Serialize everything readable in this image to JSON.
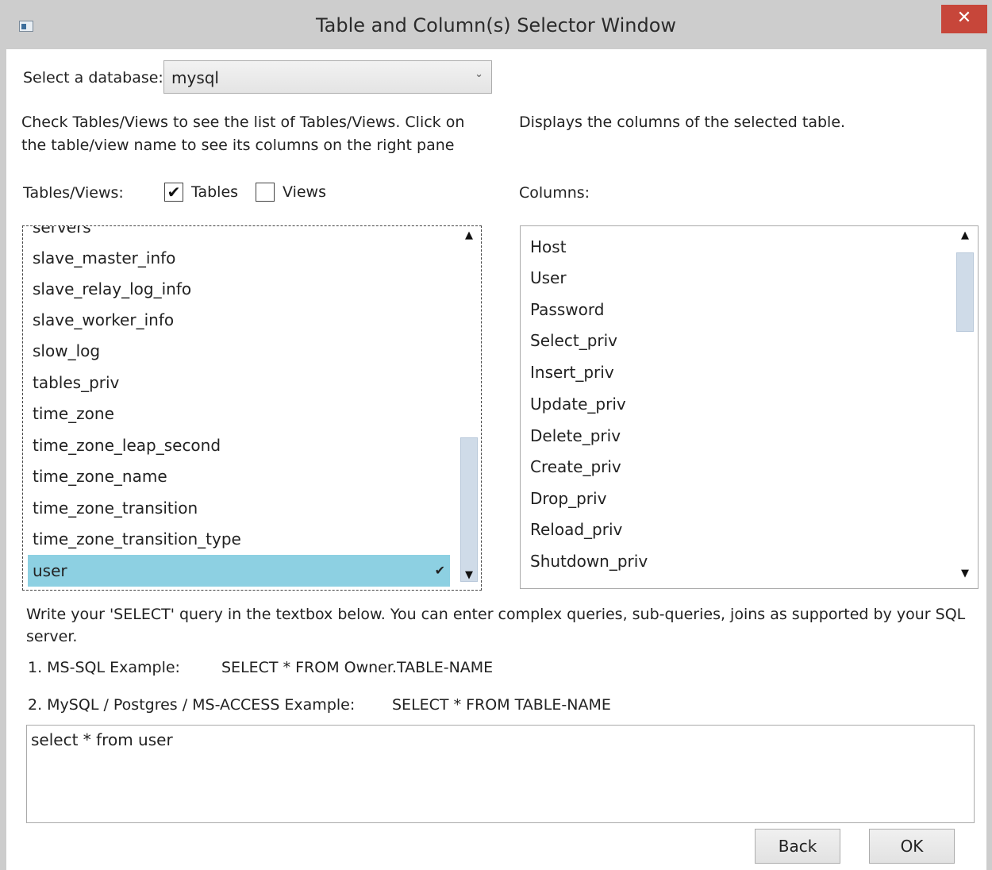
{
  "window": {
    "title": "Table and Column(s) Selector Window",
    "close_glyph": "✕"
  },
  "database": {
    "label": "Select a database:",
    "selected": "mysql",
    "arrow": "⌄"
  },
  "left_help": {
    "line1": "Check Tables/Views to see the list of Tables/Views. Click on",
    "line2": "the table/view name to see its columns on the right pane"
  },
  "right_help": "Displays the columns of the selected table.",
  "filters": {
    "label": "Tables/Views:",
    "tables": {
      "label": "Tables",
      "checked": true,
      "mark": "✔"
    },
    "views": {
      "label": "Views",
      "checked": false,
      "mark": ""
    }
  },
  "columns_label": "Columns:",
  "tables_list": {
    "partial_top": "servers",
    "items": [
      "slave_master_info",
      "slave_relay_log_info",
      "slave_worker_info",
      "slow_log",
      "tables_priv",
      "time_zone",
      "time_zone_leap_second",
      "time_zone_name",
      "time_zone_transition",
      "time_zone_transition_type"
    ],
    "selected": "user",
    "selected_mark": "✔"
  },
  "columns_list": {
    "items": [
      "Host",
      "User",
      "Password",
      "Select_priv",
      "Insert_priv",
      "Update_priv",
      "Delete_priv",
      "Create_priv",
      "Drop_priv",
      "Reload_priv",
      "Shutdown_priv"
    ]
  },
  "scroll": {
    "up": "▲",
    "down": "▼"
  },
  "query_help": {
    "line1": "Write your 'SELECT' query in the textbox below. You can enter complex queries, sub-queries, joins as supported by your SQL",
    "line2": "server.",
    "ex1_label": "1. MS-SQL Example:",
    "ex1_sql": "SELECT * FROM Owner.TABLE-NAME",
    "ex2_label": "2. MySQL / Postgres / MS-ACCESS Example:",
    "ex2_sql": "SELECT * FROM TABLE-NAME"
  },
  "query_text": "select * from user",
  "buttons": {
    "back": "Back",
    "ok": "OK"
  }
}
